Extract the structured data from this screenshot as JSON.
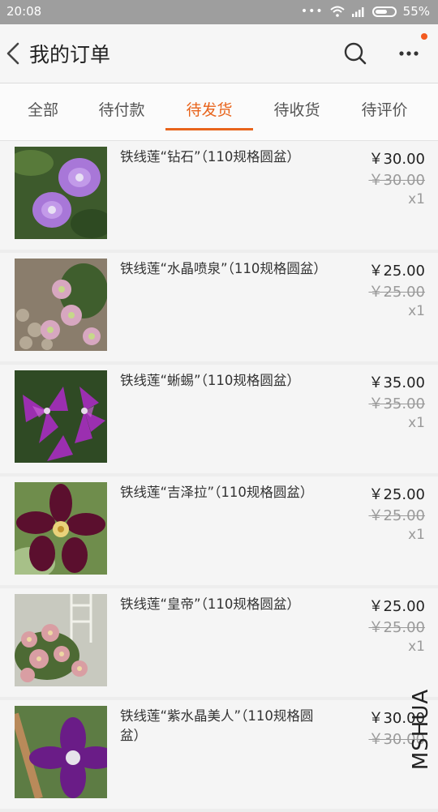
{
  "status": {
    "time": "20:08",
    "battery": "55%"
  },
  "header": {
    "title": "我的订单"
  },
  "tabs": [
    {
      "label": "全部",
      "active": false
    },
    {
      "label": "待付款",
      "active": false
    },
    {
      "label": "待发货",
      "active": true
    },
    {
      "label": "待收货",
      "active": false
    },
    {
      "label": "待评价",
      "active": false
    }
  ],
  "colors": {
    "accent": "#e8641c",
    "badge": "#f35a1f"
  },
  "orders": [
    {
      "title": "铁线莲“钻石”（110规格圆盆）",
      "price": "￥30.00",
      "original_price": "￥30.00",
      "quantity": "x1"
    },
    {
      "title": "铁线莲“水晶喷泉”（110规格圆盆）",
      "price": "￥25.00",
      "original_price": "￥25.00",
      "quantity": "x1"
    },
    {
      "title": "铁线莲“蜥蜴”（110规格圆盆）",
      "price": "￥35.00",
      "original_price": "￥35.00",
      "quantity": "x1"
    },
    {
      "title": "铁线莲“吉泽拉”（110规格圆盆）",
      "price": "￥25.00",
      "original_price": "￥25.00",
      "quantity": "x1"
    },
    {
      "title": "铁线莲“皇帝”（110规格圆盆）",
      "price": "￥25.00",
      "original_price": "￥25.00",
      "quantity": "x1"
    },
    {
      "title": "铁线莲“紫水晶美人”（110规格圆盆）",
      "price": "￥30.00",
      "original_price": "￥30.00",
      "quantity": ""
    }
  ],
  "watermark": "MSHUA"
}
